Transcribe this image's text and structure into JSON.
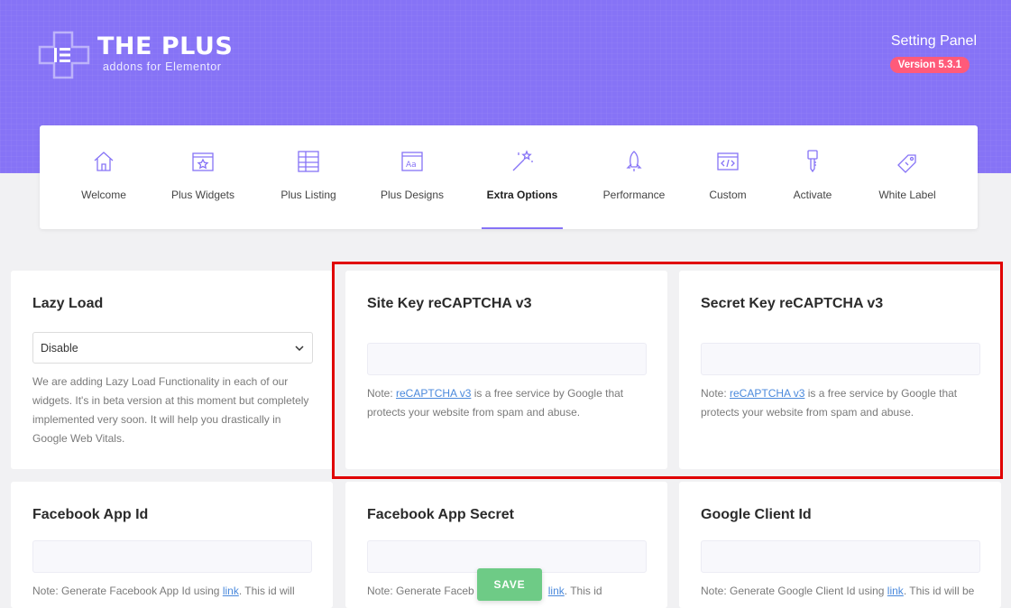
{
  "header": {
    "brand_title": "THE PLUS",
    "brand_subtitle": "addons for Elementor",
    "panel_title": "Setting Panel",
    "version": "Version 5.3.1"
  },
  "tabs": [
    {
      "label": "Welcome",
      "icon": "home-icon"
    },
    {
      "label": "Plus Widgets",
      "icon": "widget-star-icon"
    },
    {
      "label": "Plus Listing",
      "icon": "grid-listing-icon"
    },
    {
      "label": "Plus Designs",
      "icon": "designs-icon"
    },
    {
      "label": "Extra Options",
      "icon": "magic-wand-icon",
      "active": true
    },
    {
      "label": "Performance",
      "icon": "rocket-icon"
    },
    {
      "label": "Custom",
      "icon": "code-window-icon"
    },
    {
      "label": "Activate",
      "icon": "key-icon"
    },
    {
      "label": "White Label",
      "icon": "tag-icon"
    }
  ],
  "cards": {
    "lazy_load": {
      "title": "Lazy Load",
      "select_value": "Disable",
      "description": "We are adding Lazy Load Functionality in each of our widgets. It's in beta version at this moment but completely implemented very soon. It will help you drastically in Google Web Vitals."
    },
    "site_key": {
      "title": "Site Key reCAPTCHA v3",
      "value": "",
      "note_prefix": "Note: ",
      "note_link": "reCAPTCHA v3",
      "note_suffix": " is a free service by Google that protects your website from spam and abuse."
    },
    "secret_key": {
      "title": "Secret Key reCAPTCHA v3",
      "value": "",
      "note_prefix": "Note: ",
      "note_link": "reCAPTCHA v3",
      "note_suffix": " is a free service by Google that protects your website from spam and abuse."
    },
    "fb_app_id": {
      "title": "Facebook App Id",
      "value": "",
      "note_prefix": "Note: Generate Facebook App Id using ",
      "note_link": "link",
      "note_suffix": ". This id will"
    },
    "fb_app_secret": {
      "title": "Facebook App Secret",
      "value": "",
      "note_prefix": "Note: Generate Faceb",
      "note_link": "link",
      "note_suffix": ". This id"
    },
    "google_client": {
      "title": "Google Client Id",
      "value": "",
      "note_prefix": "Note: Generate Google Client Id using ",
      "note_link": "link",
      "note_suffix": ". This id will be"
    }
  },
  "save_label": "SAVE",
  "colors": {
    "accent": "#8673f6",
    "badge": "#ff5a7a",
    "save": "#6ecb86",
    "highlight": "#e00000"
  }
}
